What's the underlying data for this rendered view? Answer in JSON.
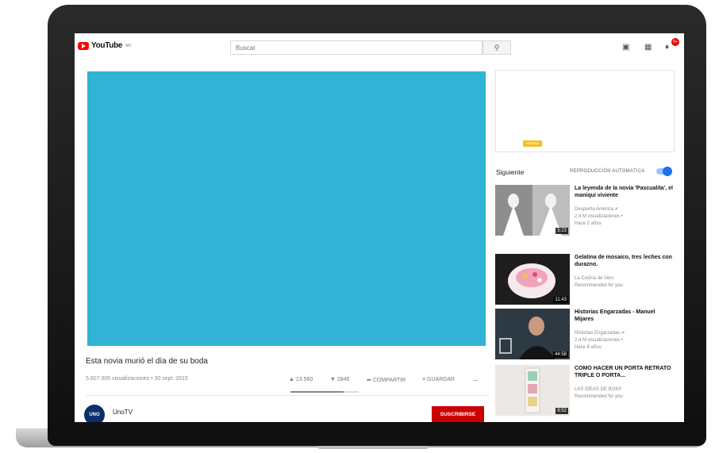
{
  "header": {
    "logo_text": "YouTube",
    "logo_superscript": "MX",
    "search_placeholder": "Buscar",
    "notification_count": "9+"
  },
  "video": {
    "title": "Esta novia murió el día de su boda",
    "meta": "5.607.005 visualizaciones • 30 sept. 2015",
    "likes": "13.560",
    "dislikes": "2846",
    "like_ratio": 0.78,
    "share_label": "COMPARTIR",
    "save_label": "GUARDAR",
    "more_label": "..."
  },
  "channel": {
    "avatar_text": "UNO",
    "name": "UnoTV",
    "subscribe_label": "SUSCRIBIRSE"
  },
  "sidebar": {
    "ad_tag": "Anuncio",
    "up_next_label": "Siguiente",
    "autoplay_label": "REPRODUCCIÓN AUTOMÁTICA"
  },
  "recommendations": [
    {
      "title": "La leyenda de la novia 'Pascualita', el maniquí viviente",
      "channel": "Despierta América",
      "verified": true,
      "views": "2,4 M visualizaciones •",
      "age": "Hace 2 años",
      "duration": "5:23"
    },
    {
      "title": "Gelatina de mosaico, tres leches con durazno.",
      "channel": "La Cocina de Vero",
      "verified": false,
      "views": "Recommended for you",
      "age": "",
      "duration": "11:43"
    },
    {
      "title": "Historias Engarzadas - Manuel Mijares",
      "channel": "Historias Engarzadas",
      "verified": true,
      "views": "2,4 M visualizaciones •",
      "age": "Hace 6 años",
      "duration": "44:58"
    },
    {
      "title": "COMO HACER UN PORTA RETRATO TRIPLE O PORTA...",
      "channel": "LAS IDEAS DE BONY",
      "verified": false,
      "views": "Recommended for you",
      "age": "",
      "duration": "8:52"
    }
  ],
  "colors": {
    "player": "#31b3d6",
    "brand_red": "#ff0000",
    "subscribe_red": "#cc0000",
    "toggle_blue": "#1a73e8"
  }
}
